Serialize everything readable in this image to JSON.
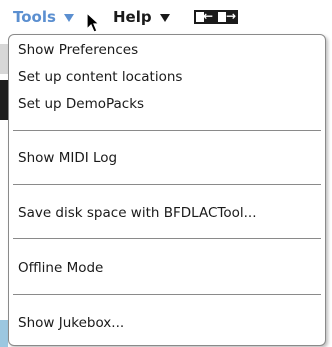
{
  "menubar": {
    "tools_label": "Tools",
    "help_label": "Help"
  },
  "tools_menu": {
    "items": [
      {
        "label": "Show Preferences"
      },
      {
        "label": "Set up content locations"
      },
      {
        "label": "Set up DemoPacks"
      },
      {
        "label": "Show MIDI Log"
      },
      {
        "label": "Save disk space with BFDLACTool..."
      },
      {
        "label": "Offline Mode"
      },
      {
        "label": "Show Jukebox..."
      }
    ]
  },
  "icons": {
    "tools_dropdown": "triangle-down-icon",
    "help_dropdown": "triangle-down-icon",
    "cursor": "mouse-pointer-icon",
    "back": "arrow-left-icon",
    "forward": "arrow-right-icon"
  },
  "colors": {
    "tools_accent": "#5b8fd0",
    "text": "#1a1a1a",
    "menu_border": "#8a8a8a"
  }
}
